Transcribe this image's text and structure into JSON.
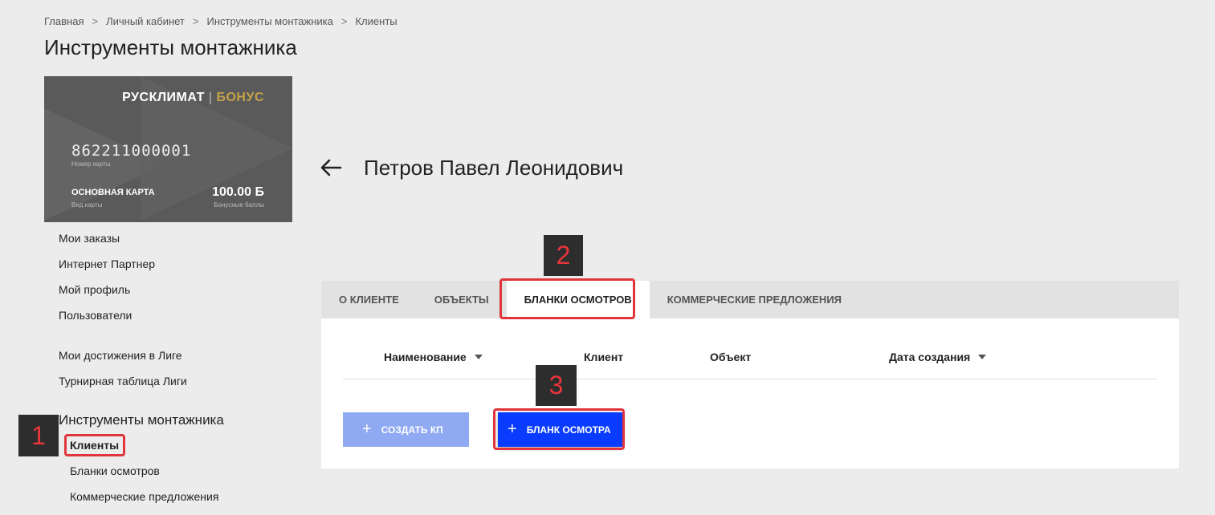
{
  "breadcrumb": [
    "Главная",
    "Личный кабинет",
    "Инструменты монтажника",
    "Клиенты"
  ],
  "breadcrumb_separator": ">",
  "page_title": "Инструменты монтажника",
  "card": {
    "brand": "РУСКЛИМАТ",
    "brand_pipe": "|",
    "brand_bonus": "БОНУС",
    "number": "862211000001",
    "number_caption": "Номер карты",
    "type": "ОСНОВНАЯ КАРТА",
    "type_caption": "Вид карты",
    "points": "100.00 Б",
    "points_caption": "Бонусные баллы"
  },
  "menu": {
    "items": [
      "Мои заказы",
      "Интернет Партнер",
      "Мой профиль",
      "Пользователи"
    ],
    "league_items": [
      "Мои достижения в Лиге",
      "Турнирная таблица Лиги"
    ],
    "section_title": "Инструменты монтажника",
    "sub_items": [
      "Клиенты",
      "Бланки осмотров",
      "Коммерческие предложения"
    ],
    "active_sub": "Клиенты"
  },
  "client": {
    "back_icon": "arrow-left-icon",
    "name": "Петров Павел Леонидович"
  },
  "tabs": [
    "О КЛИЕНТЕ",
    "ОБЪЕКТЫ",
    "БЛАНКИ ОСМОТРОВ",
    "КОММЕРЧЕСКИЕ ПРЕДЛОЖЕНИЯ"
  ],
  "active_tab": "БЛАНКИ ОСМОТРОВ",
  "table": {
    "columns": [
      "Наименование",
      "Клиент",
      "Объект",
      "Дата создания"
    ]
  },
  "buttons": {
    "create_kp": "СОЗДАТЬ КП",
    "blank": "БЛАНК ОСМОТРА",
    "plus": "+"
  },
  "annotations": [
    "1",
    "2",
    "3"
  ],
  "colors": {
    "accent": "#0a3cff",
    "accent_disabled": "#8fa9f3",
    "highlight": "#e0353b",
    "bonus_gold": "#c6a24a"
  }
}
